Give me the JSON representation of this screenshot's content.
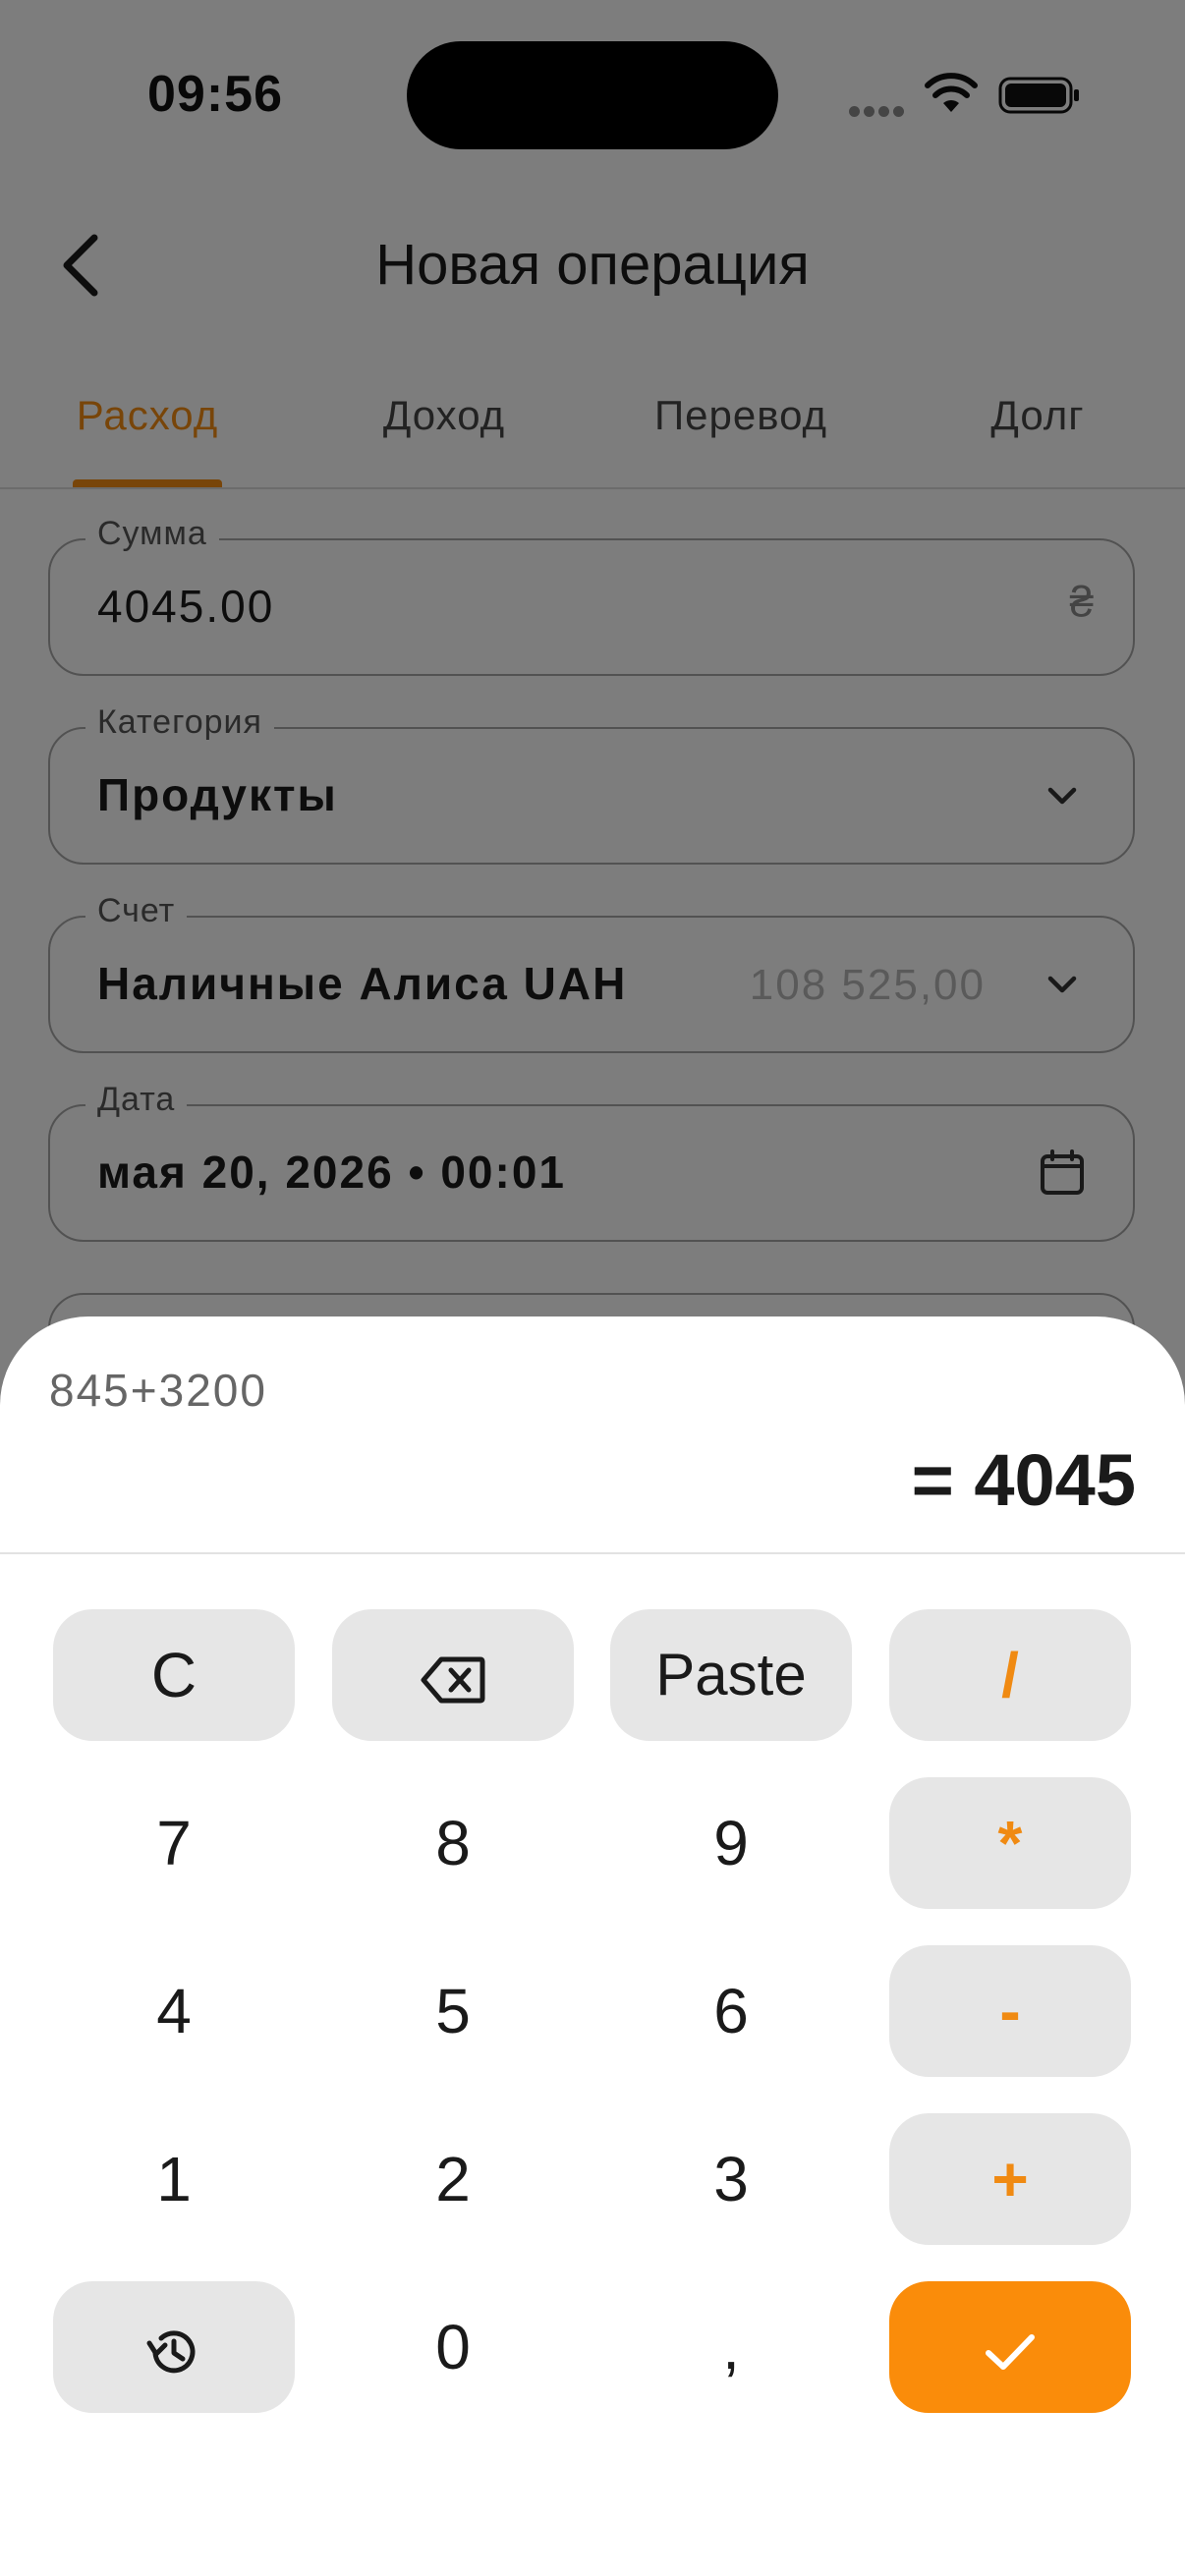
{
  "status_bar": {
    "time": "09:56"
  },
  "header": {
    "title": "Новая операция",
    "back_icon": "chevron-left-icon"
  },
  "tabs": [
    {
      "label": "Расход",
      "active": true
    },
    {
      "label": "Доход",
      "active": false
    },
    {
      "label": "Перевод",
      "active": false
    },
    {
      "label": "Долг",
      "active": false
    }
  ],
  "form": {
    "amount": {
      "label": "Сумма",
      "value": "4045.00",
      "currency_symbol": "₴"
    },
    "category": {
      "label": "Категория",
      "value": "Продукты",
      "icon": "chevron-down-icon"
    },
    "account": {
      "label": "Счет",
      "value": "Наличные Алиса UAH",
      "balance": "108 525,00",
      "icon": "chevron-down-icon"
    },
    "date": {
      "label": "Дата",
      "value": "мая 20, 2026 • 00:01",
      "icon": "calendar-icon"
    }
  },
  "calculator": {
    "expression": "845+3200",
    "result": "= 4045",
    "keys": {
      "clear": "C",
      "backspace": "backspace-icon",
      "paste": "Paste",
      "divide": "/",
      "multiply": "*",
      "subtract": "-",
      "add": "+",
      "digit_7": "7",
      "digit_8": "8",
      "digit_9": "9",
      "digit_4": "4",
      "digit_5": "5",
      "digit_6": "6",
      "digit_1": "1",
      "digit_2": "2",
      "digit_3": "3",
      "digit_0": "0",
      "decimal": ",",
      "history": "history-icon",
      "confirm": "checkmark-icon"
    }
  },
  "colors": {
    "accent": "#f08a12",
    "confirm_button": "#fa8c0a",
    "key_background": "#e6e6e6",
    "overlay": "rgba(0,0,0,0.5)"
  }
}
